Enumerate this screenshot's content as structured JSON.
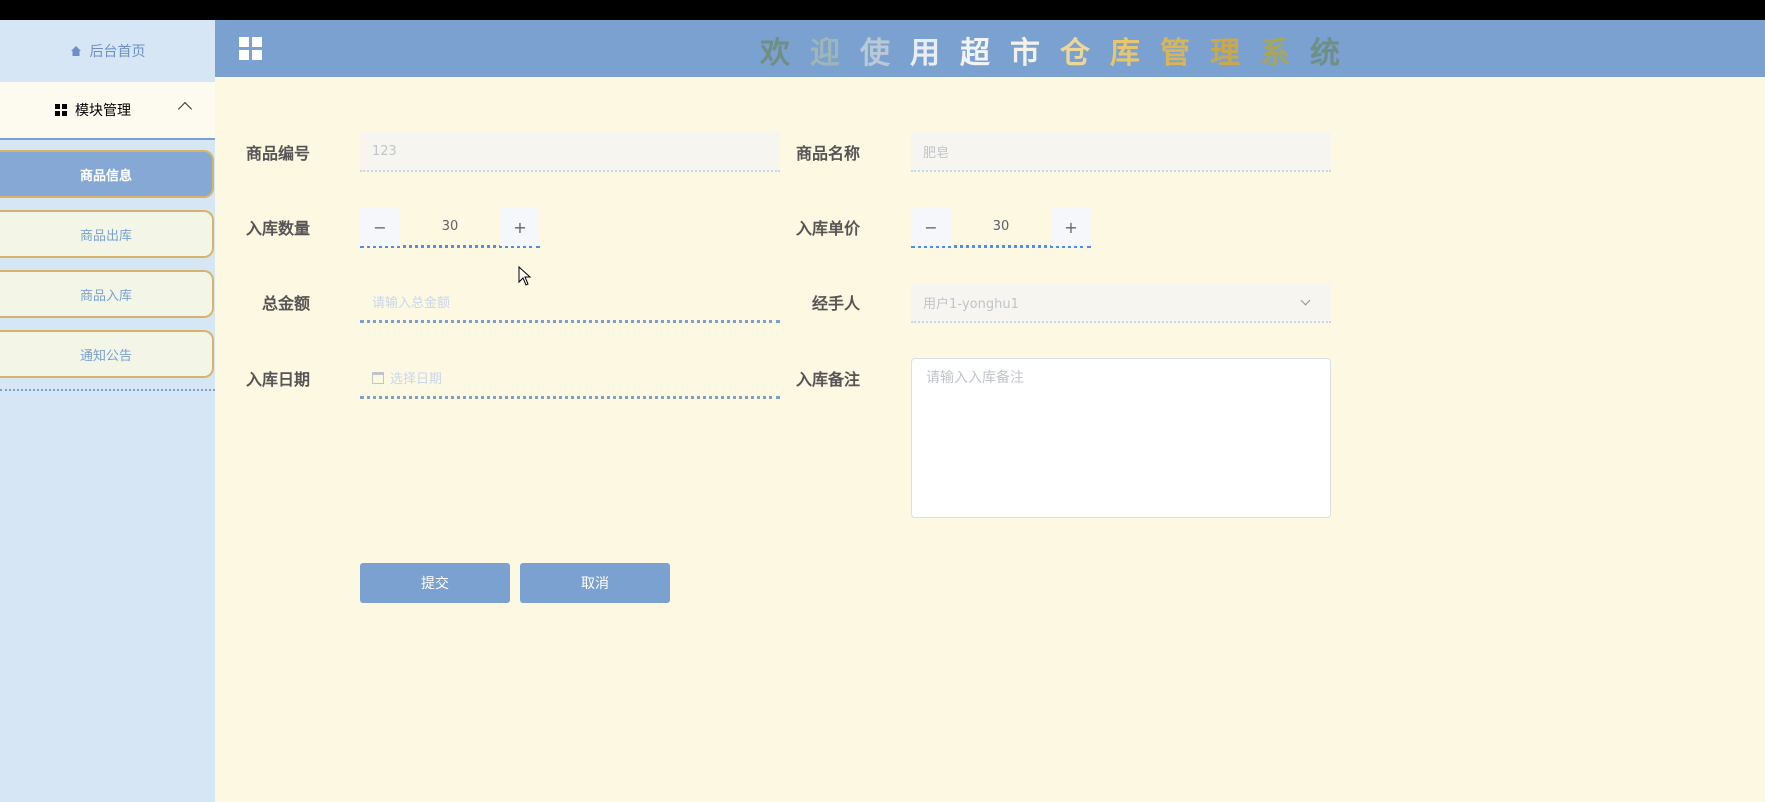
{
  "sidebar": {
    "home_label": "后台首页",
    "module_label": "模块管理",
    "items": [
      {
        "label": "商品信息",
        "active": true
      },
      {
        "label": "商品出库",
        "active": false
      },
      {
        "label": "商品入库",
        "active": false
      },
      {
        "label": "通知公告",
        "active": false
      }
    ]
  },
  "header": {
    "title_chars": [
      "欢",
      "迎",
      "使",
      "用",
      "超",
      "市",
      "仓",
      "库",
      "管",
      "理",
      "系",
      "统"
    ],
    "title_colors": [
      "#6f8f86",
      "#9fb6b8",
      "#b9c9d6",
      "#e9eef6",
      "#f1f3f4",
      "#f3f1ea",
      "#ecd79a",
      "#e6c66f",
      "#d9b458",
      "#caa84e",
      "#a6a663",
      "#6f8f86"
    ]
  },
  "form": {
    "product_code_label": "商品编号",
    "product_code_value": "123",
    "product_name_label": "商品名称",
    "product_name_value": "肥皂",
    "in_quantity_label": "入库数量",
    "in_quantity_value": "30",
    "in_price_label": "入库单价",
    "in_price_value": "30",
    "total_label": "总金额",
    "total_placeholder": "请输入总金额",
    "handler_label": "经手人",
    "handler_value": "用户1-yonghu1",
    "in_date_label": "入库日期",
    "in_date_placeholder": "选择日期",
    "in_note_label": "入库备注",
    "in_note_placeholder": "请输入入库备注",
    "submit_label": "提交",
    "cancel_label": "取消",
    "minus": "−",
    "plus": "+"
  }
}
